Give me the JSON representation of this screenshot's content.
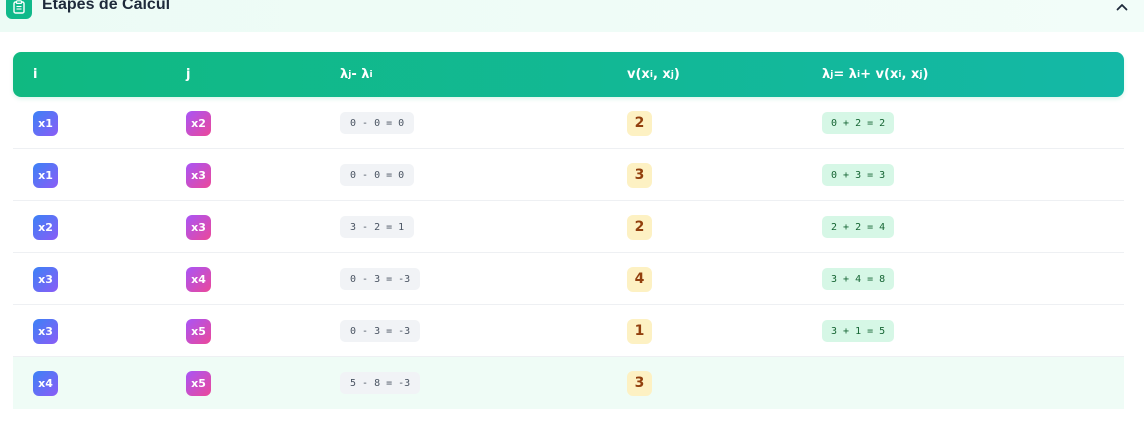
{
  "panel": {
    "title": "Étapes de Calcul",
    "icon": "clipboard-icon",
    "collapse_icon": "chevron-up-icon"
  },
  "table": {
    "headers": {
      "i": "i",
      "j": "j",
      "diff_main": "λ",
      "diff_sub1": "j",
      "diff_mid": " - λ",
      "diff_sub2": "i",
      "v_main": "v(x",
      "v_sub1": "i",
      "v_mid": ", x",
      "v_sub2": "j",
      "v_end": ")",
      "upd_a": "λ",
      "upd_sub1": "j",
      "upd_b": " = λ",
      "upd_sub2": "i",
      "upd_c": " + v(x",
      "upd_sub3": "i",
      "upd_d": ", x",
      "upd_sub4": "j",
      "upd_e": ")"
    },
    "rows": [
      {
        "i": "x1",
        "j": "x2",
        "diff": "0 - 0 = 0",
        "v": "2",
        "update": "0 + 2 = 2",
        "highlight": false
      },
      {
        "i": "x1",
        "j": "x3",
        "diff": "0 - 0 = 0",
        "v": "3",
        "update": "0 + 3 = 3",
        "highlight": false
      },
      {
        "i": "x2",
        "j": "x3",
        "diff": "3 - 2 = 1",
        "v": "2",
        "update": "2 + 2 = 4",
        "highlight": false
      },
      {
        "i": "x3",
        "j": "x4",
        "diff": "0 - 3 = -3",
        "v": "4",
        "update": "3 + 4 = 8",
        "highlight": false
      },
      {
        "i": "x3",
        "j": "x5",
        "diff": "0 - 3 = -3",
        "v": "1",
        "update": "3 + 1 = 5",
        "highlight": false
      },
      {
        "i": "x4",
        "j": "x5",
        "diff": "5 - 8 = -3",
        "v": "3",
        "update": "",
        "highlight": true
      }
    ]
  },
  "colors": {
    "accent": "#10b981",
    "header_gradient_end": "#14b8a6",
    "weight_bg": "#fdf1c3",
    "result_bg": "#d6f7e6"
  }
}
